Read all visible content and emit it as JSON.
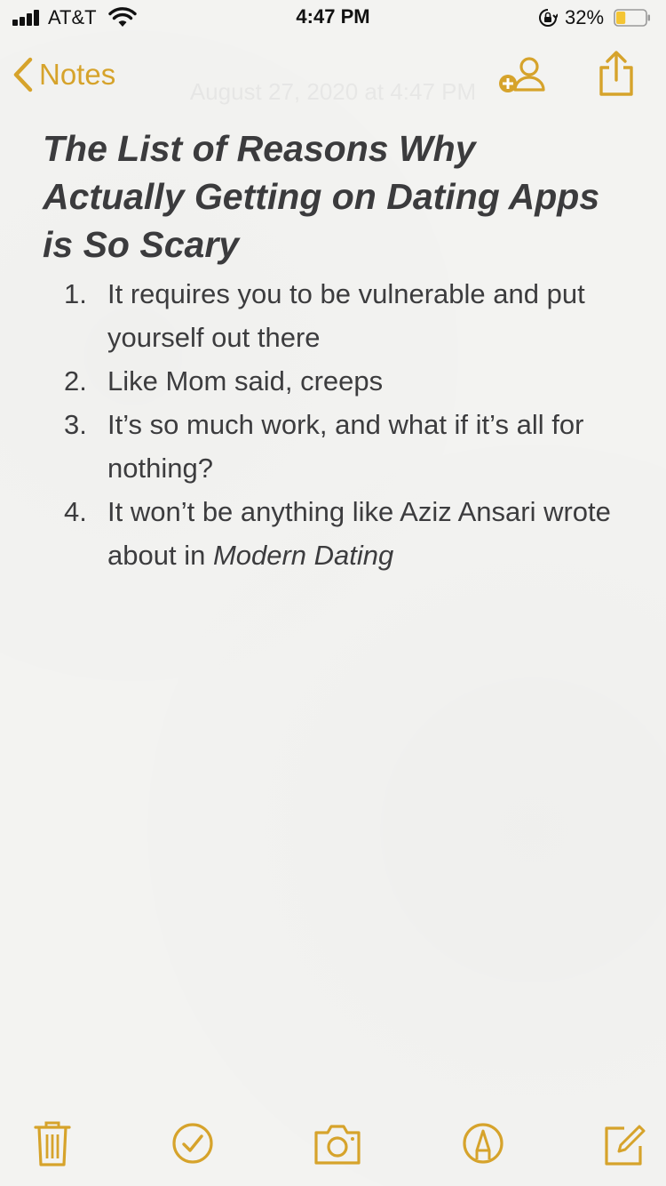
{
  "status_bar": {
    "carrier": "AT&T",
    "time": "4:47 PM",
    "battery_percent": "32%",
    "battery_level": 0.32,
    "icons": [
      "signal-bars-icon",
      "wifi-icon",
      "orientation-lock-icon",
      "battery-icon"
    ]
  },
  "nav": {
    "back_label": "Notes",
    "faint_date": "August 27, 2020 at 4:47 PM",
    "icons": [
      "add-person-icon",
      "share-icon"
    ]
  },
  "note": {
    "title": "The List of Reasons Why Actually Getting on Dating Apps is So Scary",
    "items": [
      {
        "num": "1.",
        "text": "It requires you to be vulnerable and put yourself out there"
      },
      {
        "num": "2.",
        "text": "Like Mom said, creeps"
      },
      {
        "num": "3.",
        "text": "It’s so much work, and what if it’s all for nothing?"
      },
      {
        "num": "4.",
        "text_before": "It won’t be anything like Aziz Ansari wrote about in ",
        "text_italic": "Modern Dating"
      }
    ]
  },
  "toolbar": {
    "icons": [
      "trash-icon",
      "checklist-icon",
      "camera-icon",
      "markup-icon",
      "compose-icon"
    ]
  },
  "colors": {
    "accent": "#d6a32b",
    "background": "#f3f3f1",
    "text": "#3c3c3e"
  }
}
